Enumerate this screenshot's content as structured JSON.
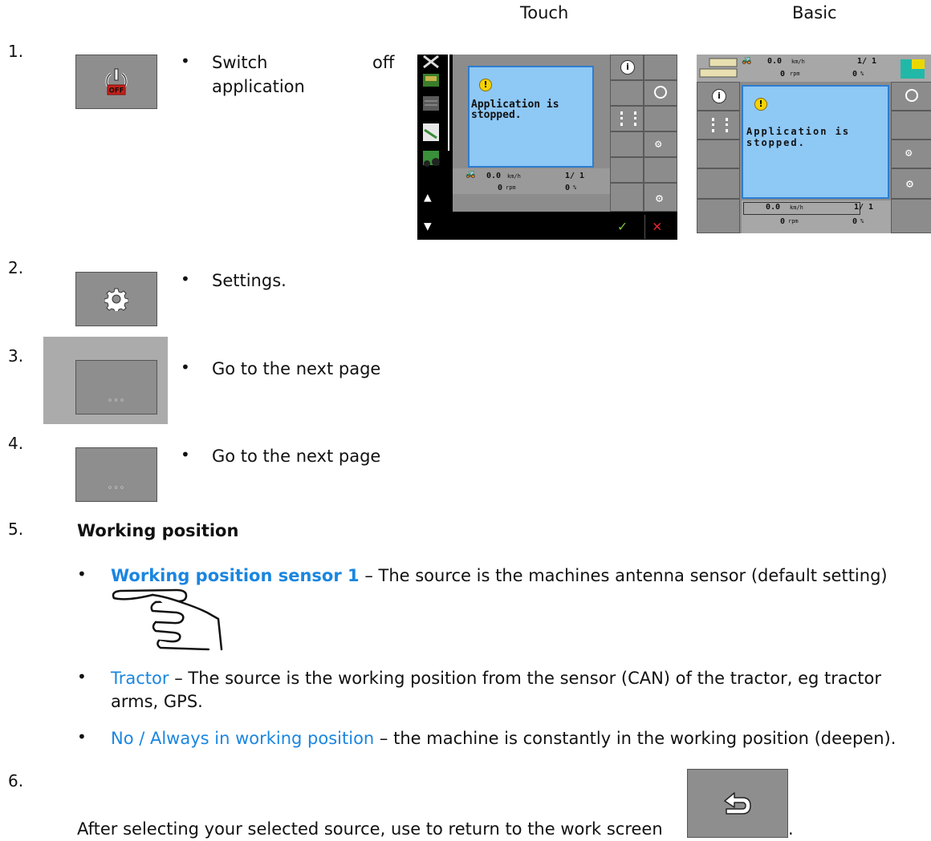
{
  "header": {
    "col_touch": "Touch",
    "col_basic": "Basic"
  },
  "steps": [
    {
      "num": "1.",
      "text": "Switch off application",
      "text_line1": "Switch",
      "text_line1_right": "off",
      "text_line2": "application",
      "icon": "power-off-icon",
      "icon_badge": "OFF"
    },
    {
      "num": "2.",
      "text": "Settings.",
      "icon": "gear-icon"
    },
    {
      "num": "3.",
      "text": "Go to the next page",
      "icon": "ellipsis-icon",
      "icon_glyph": "◦◦◦"
    },
    {
      "num": "4.",
      "text": "Go to the next page",
      "icon": "ellipsis-icon",
      "icon_glyph": "◦◦◦"
    },
    {
      "num": "5.",
      "title": "Working position"
    },
    {
      "num": "6.",
      "text": "After selecting your selected source, use to return to the work screen",
      "end": ".",
      "icon": "return-arrow-icon"
    }
  ],
  "options": [
    {
      "label": "Working position sensor 1",
      "desc": " – The source is the machines antenna sensor (default setting)",
      "bold": true
    },
    {
      "label": "Tractor",
      "desc": " – The source is the working position from the sensor (CAN) of the tractor, eg tractor",
      "desc2": "arms, GPS."
    },
    {
      "label": "No / Always in working position",
      "desc": " – the machine is constantly in the working position (deepen)."
    }
  ],
  "touch_screen": {
    "message_line1": "Application is",
    "message_line2": "stopped.",
    "speed": "0.0",
    "speed_unit": "km/h",
    "rpm": "0",
    "rpm_unit": "rpm",
    "section": "1/ 1",
    "percent": "0",
    "percent_unit": "%"
  },
  "basic_screen": {
    "message_line1": "Application is",
    "message_line2": "stopped.",
    "speed": "0.0",
    "speed_unit": "km/h",
    "rpm": "0",
    "rpm_unit": "rpm",
    "section": "1/ 1",
    "percent": "0",
    "percent_unit": "%"
  },
  "colors": {
    "blue_link": "#1a86e0",
    "button_gray": "#8e8e8e",
    "screen_blue": "#8ec8f5",
    "ok_green": "#7fc241",
    "cancel_red": "#e0232b"
  }
}
